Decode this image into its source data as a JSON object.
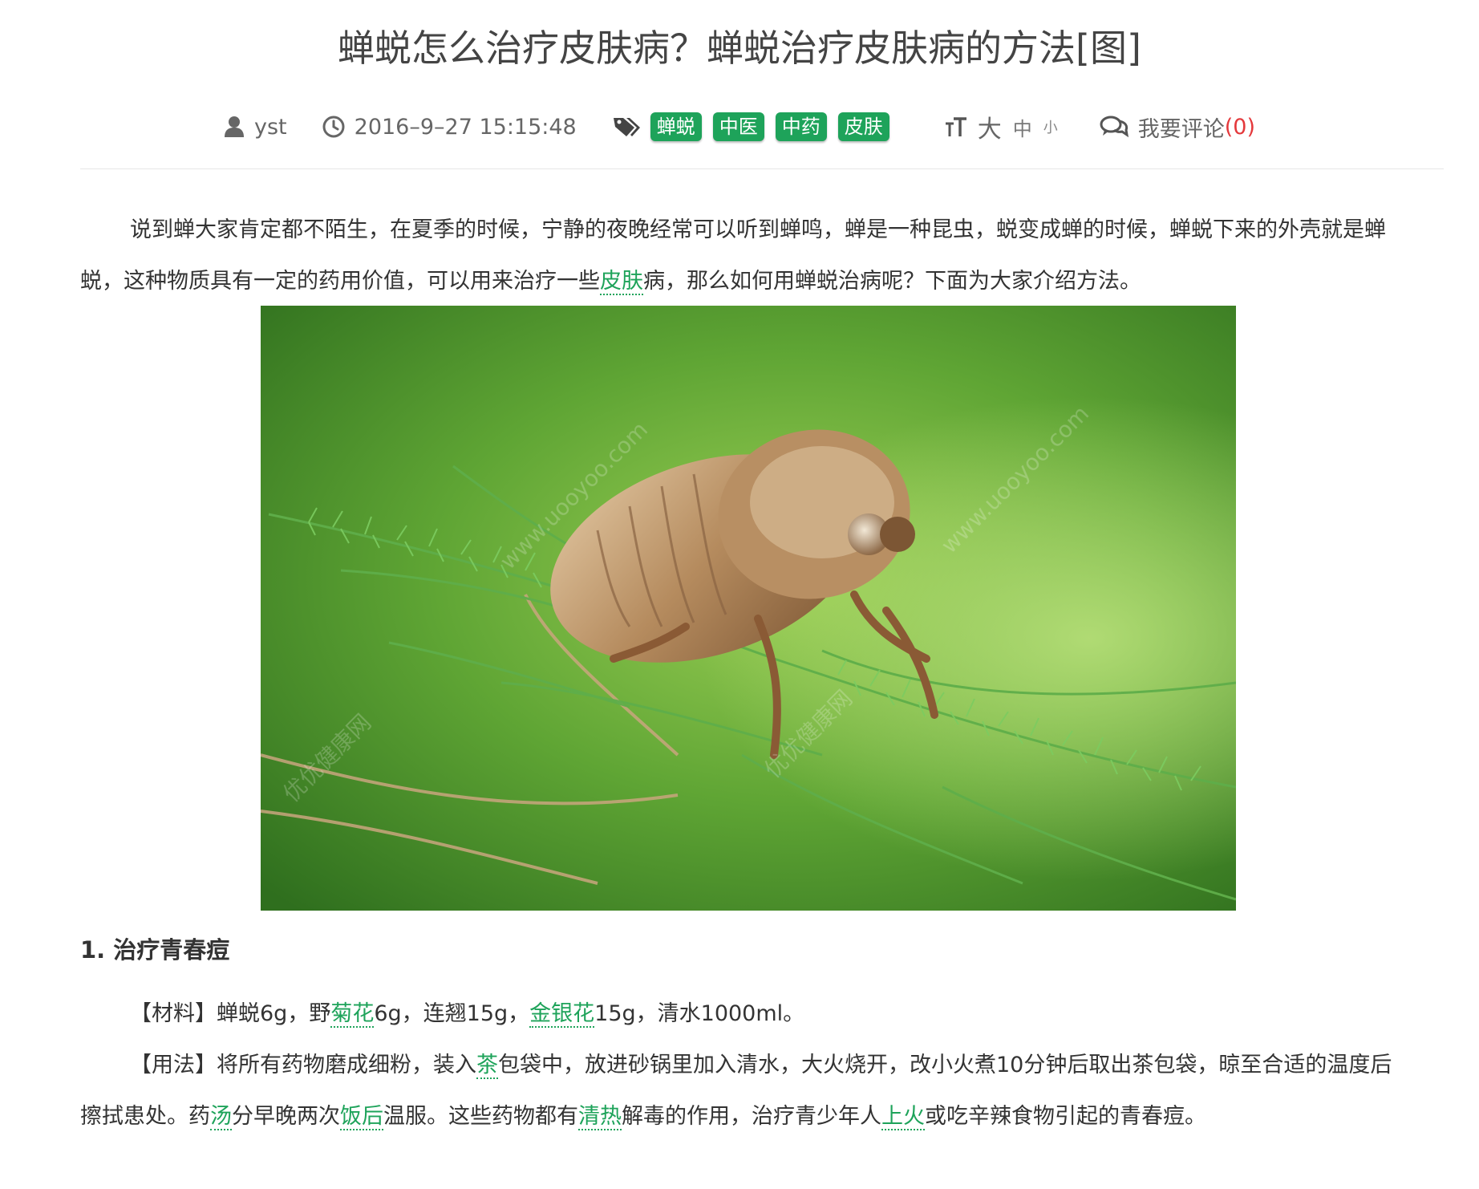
{
  "article": {
    "title": "蝉蜕怎么治疗皮肤病？蝉蜕治疗皮肤病的方法[图]",
    "meta": {
      "author": "yst",
      "datetime": "2016–9–27 15:15:48",
      "tags": [
        "蝉蜕",
        "中医",
        "中药",
        "皮肤"
      ],
      "font_size_options": {
        "large": "大",
        "medium": "中",
        "small": "小"
      },
      "comment_label": "我要评论",
      "comment_count": "(0)"
    },
    "intro": {
      "part1": "说到蝉大家肯定都不陌生，在夏季的时候，宁静的夜晚经常可以听到蝉鸣，蝉是一种昆虫，蜕变成蝉的时候，蝉蜕下来的外壳就是蝉蜕，这种物质具有一定的药用价值，可以用来治疗一些",
      "link1": "皮肤",
      "part2": "病，那么如何用蝉蜕治病呢？下面为大家介绍方法。"
    },
    "image": {
      "watermark_url": "www.uooyoo.com",
      "watermark_name": "优优健康网"
    },
    "section1": {
      "heading": "1. 治疗青春痘",
      "materials": {
        "p1": "【材料】蝉蜕6g，野",
        "link1": "菊花",
        "p2": "6g，连翘15g，",
        "link2": "金银花",
        "p3": "15g，清水1000ml。"
      },
      "usage": {
        "p1": "【用法】将所有药物磨成细粉，装入",
        "link1": "茶",
        "p2": "包袋中，放进砂锅里加入清水，大火烧开，改小火煮10分钟后取出茶包袋，晾至合适的温度后擦拭患处。药",
        "link2": "汤",
        "p3": "分早晚两次",
        "link3": "饭后",
        "p4": "温服。这些药物都有",
        "link4": "清热",
        "p5": "解毒的作用，治疗青少年人",
        "link5": "上火",
        "p6": "或吃辛辣食物引起的青春痘。"
      }
    }
  },
  "colors": {
    "tag_green": "#1ea35a",
    "comment_red": "#e4393c",
    "text": "#333333"
  }
}
